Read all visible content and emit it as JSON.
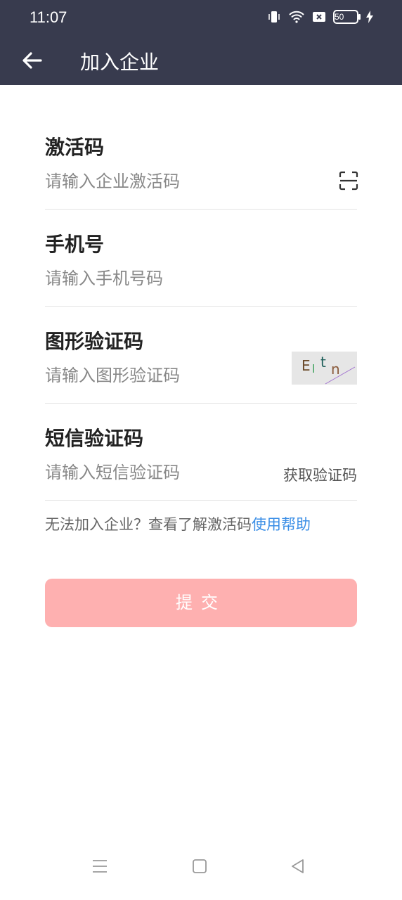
{
  "status": {
    "time": "11:07",
    "battery": "50"
  },
  "header": {
    "title": "加入企业"
  },
  "fields": [
    {
      "label": "激活码",
      "placeholder": "请输入企业激活码"
    },
    {
      "label": "手机号",
      "placeholder": "请输入手机号码"
    },
    {
      "label": "图形验证码",
      "placeholder": "请输入图形验证码"
    },
    {
      "label": "短信验证码",
      "placeholder": "请输入短信验证码"
    }
  ],
  "captcha": {
    "text": "Eltn"
  },
  "sms": {
    "get_code_label": "获取验证码"
  },
  "help": {
    "text": "无法加入企业？查看了解激活码",
    "link": "使用帮助"
  },
  "submit": {
    "label": "提交"
  },
  "colors": {
    "header": "#383b4e",
    "submit": "#feb0b0",
    "link": "#3a8ee6"
  }
}
